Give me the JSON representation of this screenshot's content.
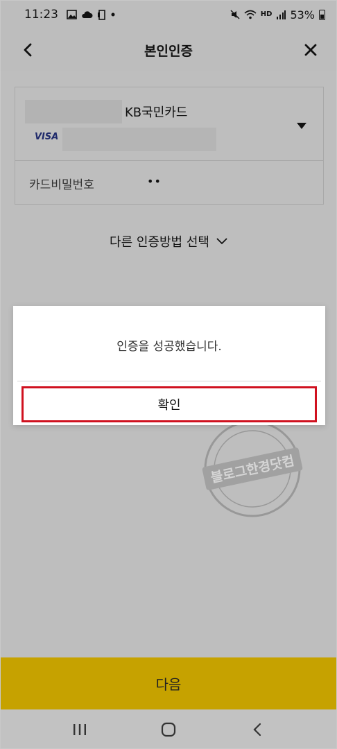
{
  "status_bar": {
    "time": "11:23",
    "battery": "53%",
    "network_label": "HD"
  },
  "header": {
    "title": "본인인증"
  },
  "card": {
    "name": "KB국민카드",
    "brand": "VISA",
    "pin_label": "카드비밀번호",
    "pin_value": "••"
  },
  "other_method": {
    "label": "다른 인증방법 선택"
  },
  "dialog": {
    "message": "인증을 성공했습니다.",
    "confirm_label": "확인"
  },
  "watermark": {
    "text": "블로그한경닷컴"
  },
  "footer": {
    "next_label": "다음"
  },
  "colors": {
    "accent": "#c6a200",
    "highlight": "#d0111f",
    "overlay": "#bebebe"
  }
}
